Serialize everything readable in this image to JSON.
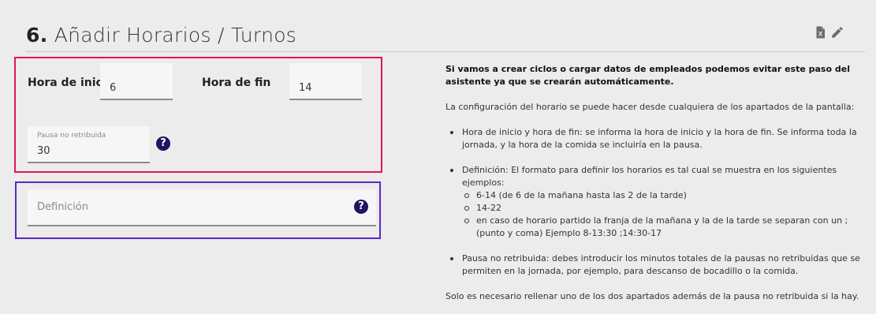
{
  "header": {
    "step_number": "6.",
    "title": "Añadir Horarios / Turnos"
  },
  "schedule": {
    "start_label": "Hora de inicio",
    "start_value": "6",
    "end_label": "Hora de fin",
    "end_value": "14",
    "break_label": "Pausa no retribuida",
    "break_value": "30",
    "help_glyph": "?"
  },
  "definition": {
    "placeholder": "Definición",
    "help_glyph": "?"
  },
  "info": {
    "intro": "Si vamos a crear ciclos o cargar datos de empleados podemos evitar este paso del asistente ya que se crearán automáticamente.",
    "config": "La configuración del horario se puede hacer desde cualquiera de los apartados de la pantalla:",
    "bullet1": "Hora de inicio y hora de fin: se informa la hora de inicio y la hora de fin. Se informa toda la jornada, y la hora de la comida se incluiría en la pausa.",
    "bullet2": "Definición: El formato para definir los horarios es tal cual se muestra en los siguientes ejemplos:",
    "sub1": "6-14 (de 6 de la mañana hasta las 2 de la tarde)",
    "sub2": "14-22",
    "sub3": "en caso de horario partido la franja de la mañana y la de la tarde se separan con un ; (punto y coma) Ejemplo 8-13:30 ;14:30-17",
    "bullet3": "Pausa no retribuida: debes introducir los minutos totales de la pausas no retribuidas que se permiten en la jornada, por ejemplo, para descanso de bocadillo o la comida.",
    "footer": "Solo es necesario rellenar uno de los dos apartados además de la pausa no retribuida si la hay."
  },
  "icons": {
    "export": "excel-file-icon",
    "edit": "pencil-icon"
  },
  "colors": {
    "background": "#ececec",
    "red_box": "#e0174f",
    "purple_box": "#5b27c5",
    "help_icon": "#1c1560"
  }
}
